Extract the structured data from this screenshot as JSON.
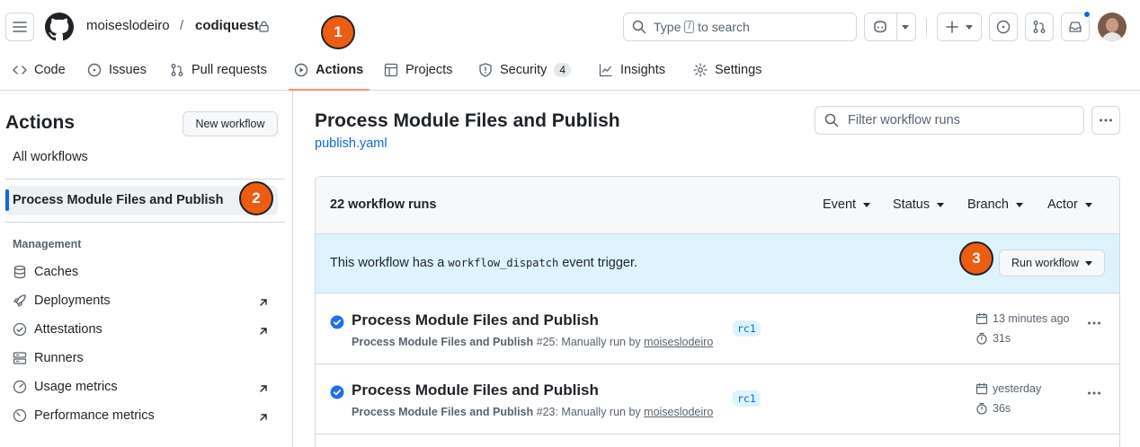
{
  "header": {
    "owner": "moiseslodeiro",
    "separator": "/",
    "repo": "codiquest",
    "search_prefix": "Type",
    "search_key": "/",
    "search_suffix": "to search"
  },
  "tabs": [
    {
      "label": "Code"
    },
    {
      "label": "Issues"
    },
    {
      "label": "Pull requests"
    },
    {
      "label": "Actions"
    },
    {
      "label": "Projects"
    },
    {
      "label": "Security",
      "count": "4"
    },
    {
      "label": "Insights"
    },
    {
      "label": "Settings"
    }
  ],
  "badges": [
    "1",
    "2",
    "3"
  ],
  "sidebar": {
    "title": "Actions",
    "new_workflow": "New workflow",
    "all_workflows": "All workflows",
    "active_workflow": "Process Module Files and Publish",
    "section": "Management",
    "items": [
      {
        "label": "Caches",
        "icon": "database-icon"
      },
      {
        "label": "Deployments",
        "icon": "rocket-icon"
      },
      {
        "label": "Attestations",
        "icon": "verified-icon"
      },
      {
        "label": "Runners",
        "icon": "server-icon"
      },
      {
        "label": "Usage metrics",
        "icon": "graph-icon"
      },
      {
        "label": "Performance metrics",
        "icon": "meter-icon"
      }
    ]
  },
  "main": {
    "title": "Process Module Files and Publish",
    "file": "publish.yaml",
    "filter_placeholder": "Filter workflow runs",
    "runs_count": "22 workflow runs",
    "filters": [
      "Event",
      "Status",
      "Branch",
      "Actor"
    ],
    "dispatch_pre": "This workflow has a",
    "dispatch_code": "workflow_dispatch",
    "dispatch_post": "event trigger.",
    "run_workflow": "Run workflow",
    "runs": [
      {
        "title": "Process Module Files and Publish",
        "workflow": "Process Module Files and Publish",
        "number": "#25",
        "desc": ": Manually run by",
        "actor": "moiseslodeiro",
        "branch": "rc1",
        "when": "13 minutes ago",
        "duration": "31s"
      },
      {
        "title": "Process Module Files and Publish",
        "workflow": "Process Module Files and Publish",
        "number": "#23",
        "desc": ": Manually run by",
        "actor": "moiseslodeiro",
        "branch": "rc1",
        "when": "yesterday",
        "duration": "36s"
      }
    ]
  },
  "colors": {
    "accent": "#0969da",
    "tab_underline": "#fd8c73",
    "badge": "#ec5d11",
    "success": "#1f6feb",
    "dispatch_bg": "#ddf4ff"
  }
}
